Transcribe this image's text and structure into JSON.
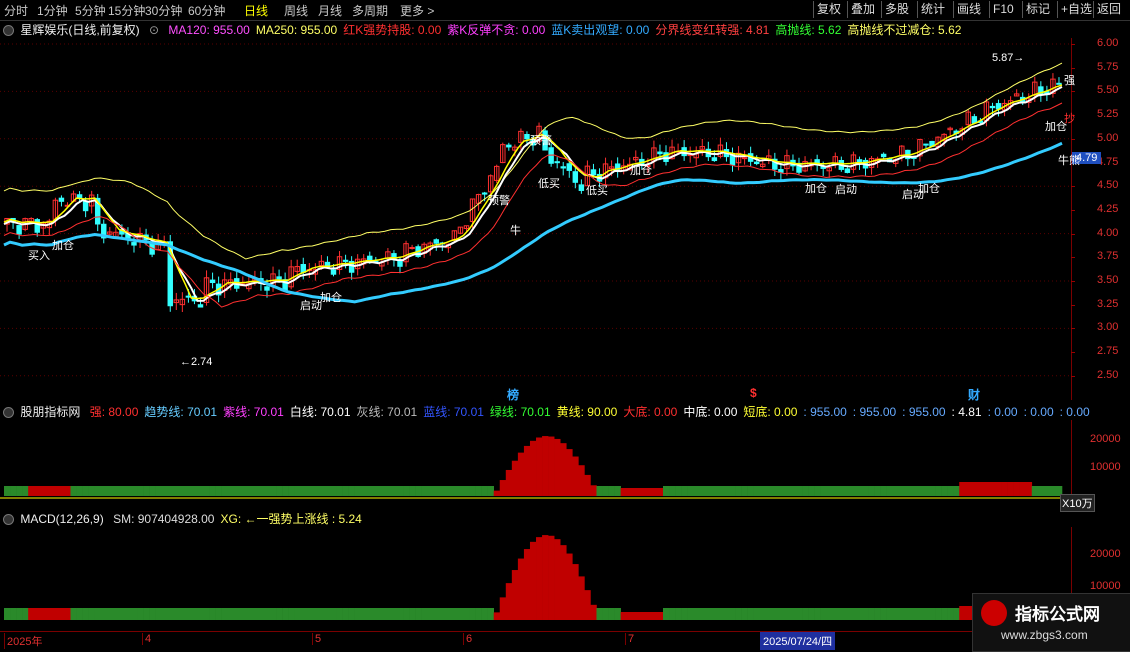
{
  "toolbar": {
    "periods": [
      "分时",
      "1分钟",
      "5分钟",
      "15分钟",
      "30分钟",
      "60分钟",
      "日线",
      "周线",
      "月线",
      "多周期",
      "更多 >"
    ],
    "active_period": "日线",
    "right_buttons": [
      "复权",
      "叠加",
      "多股",
      "统计",
      "画线",
      "F10",
      "标记",
      "+自选",
      "返回"
    ]
  },
  "main_header": {
    "title": "星辉娱乐(日线,前复权)",
    "items": [
      {
        "label": "MA120: 955.00",
        "color": "#ff4fff"
      },
      {
        "label": "MA250: 955.00",
        "color": "#ffff66"
      },
      {
        "label": "红K强势持股: 0.00",
        "color": "#ff3030"
      },
      {
        "label": "紫K反弹不贪: 0.00",
        "color": "#ff40ff"
      },
      {
        "label": "蓝K卖出观望: 0.00",
        "color": "#33aaff"
      },
      {
        "label": "分界线变红转强: 4.81",
        "color": "#ff4040"
      },
      {
        "label": "高抛线: 5.62",
        "color": "#33ff33"
      },
      {
        "label": "高抛线不过减仓: 5.62",
        "color": "#ffff66"
      }
    ]
  },
  "price_axis": {
    "ticks": [
      "6.00",
      "5.75",
      "5.50",
      "5.25",
      "5.00",
      "4.75",
      "4.50",
      "4.25",
      "4.00",
      "3.75",
      "3.50",
      "3.25",
      "3.00",
      "2.75",
      "2.50"
    ],
    "current_price": "4.79"
  },
  "price_annotations": {
    "high": "5.87",
    "low": "2.74",
    "signals": [
      "买入",
      "加仓",
      "启动",
      "加仓",
      "牛",
      "预警",
      "预警",
      "低买",
      "低买",
      "加仓",
      "加仓",
      "启动",
      "加仓",
      "启动",
      "加仓",
      "牛熊"
    ],
    "event_markers": [
      "榜",
      "$",
      "财"
    ],
    "right_labels": [
      "强",
      "抄"
    ]
  },
  "indicator1_header": {
    "title": "股朋指标网",
    "items": [
      {
        "label": "强: 80.00",
        "color": "#ff3030"
      },
      {
        "label": "趋势线: 70.01",
        "color": "#66ccff"
      },
      {
        "label": "紫线: 70.01",
        "color": "#ff40ff"
      },
      {
        "label": "白线: 70.01",
        "color": "#ffffff"
      },
      {
        "label": "灰线: 70.01",
        "color": "#bbbbbb"
      },
      {
        "label": "蓝线: 70.01",
        "color": "#3355ff"
      },
      {
        "label": "绿线: 70.01",
        "color": "#33ff33"
      },
      {
        "label": "黄线: 90.00",
        "color": "#ffff33"
      },
      {
        "label": "大底: 0.00",
        "color": "#ff3030"
      },
      {
        "label": "中底: 0.00",
        "color": "#ffffff"
      },
      {
        "label": "短底: 0.00",
        "color": "#ffff33"
      },
      {
        "label": ": 955.00",
        "color": "#66aaff"
      },
      {
        "label": ": 955.00",
        "color": "#66aaff"
      },
      {
        "label": ": 955.00",
        "color": "#66aaff"
      },
      {
        "label": ": 4.81",
        "color": "#ffffff"
      },
      {
        "label": ": 0.00",
        "color": "#66aaff"
      },
      {
        "label": ": 0.00",
        "color": "#66aaff"
      },
      {
        "label": ": 0.00",
        "color": "#66aaff"
      }
    ],
    "axis_ticks": [
      "20000",
      "10000"
    ],
    "unit": "X10万",
    "corner_label": "牛熊"
  },
  "macd_header": {
    "title": "MACD(12,26,9)",
    "items": [
      {
        "label": "SM: 907404928.00",
        "color": "#dddddd"
      },
      {
        "label": "XG: ←一强势上涨线 : 5.24",
        "color": "#ffff66"
      }
    ],
    "axis_ticks": [
      "20000",
      "10000"
    ]
  },
  "date_axis": {
    "labels": [
      "2025年",
      "4",
      "5",
      "6",
      "7"
    ],
    "cursor_date": "2025/07/24/四"
  },
  "watermark": {
    "line1": "指标公式网",
    "line2": "www.zbgs3.com"
  },
  "colors": {
    "up": "#ff3030",
    "down": "#33ffff",
    "bull_line": "#33ccff",
    "yellow_band": "#ffff66",
    "green_hist": "#2a8a2a",
    "red_hist": "#c00000"
  }
}
